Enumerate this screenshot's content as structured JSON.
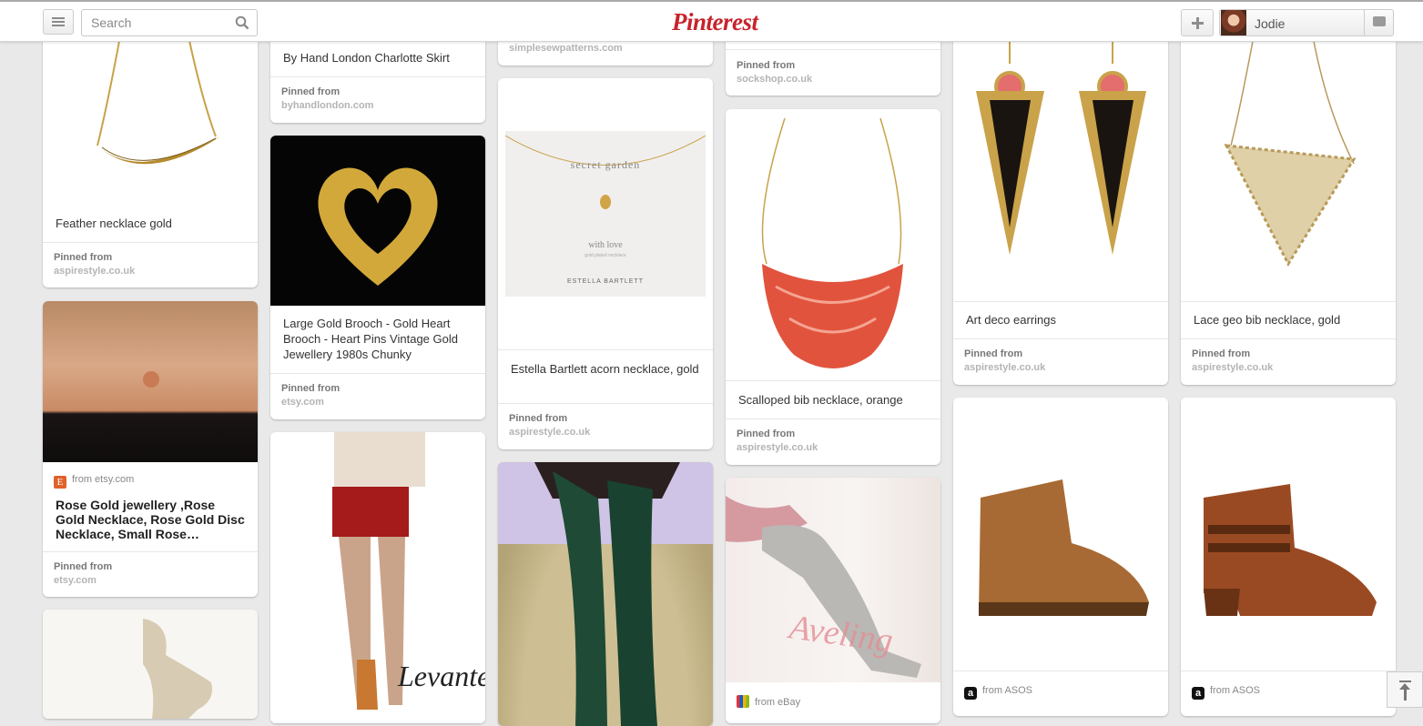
{
  "header": {
    "search_placeholder": "Search",
    "logo_text": "Pinterest",
    "user_name": "Jodie"
  },
  "pins": {
    "c1": [
      {
        "desc": "Feather necklace gold",
        "pinned_from_label": "Pinned from",
        "source": "aspirestyle.co.uk"
      },
      {
        "from_text": "from etsy.com",
        "desc": "Rose Gold jewellery ,Rose Gold Necklace, Rose Gold Disc Necklace, Small Rose…",
        "pinned_from_label": "Pinned from",
        "source": "etsy.com"
      }
    ],
    "c2": [
      {
        "desc": "By Hand London Charlotte Skirt",
        "pinned_from_label": "Pinned from",
        "source": "byhandlondon.com"
      },
      {
        "desc": "Large Gold Brooch - Gold Heart Brooch - Heart Pins Vintage Gold Jewellery 1980s Chunky",
        "pinned_from_label": "Pinned from",
        "source": "etsy.com"
      },
      {
        "watermark": "Levante"
      }
    ],
    "c3": [
      {
        "source": "simplesewpatterns.com"
      },
      {
        "card_title": "secret garden",
        "card_sub": "with love",
        "card_small": "gold plated necklace",
        "card_brand": "ESTELLA BARTLETT",
        "desc": "Estella Bartlett acorn necklace, gold",
        "pinned_from_label": "Pinned from",
        "source": "aspirestyle.co.uk"
      }
    ],
    "c4": [
      {
        "pinned_from_label": "Pinned from",
        "source": "sockshop.co.uk"
      },
      {
        "desc": "Scalloped bib necklace, orange",
        "pinned_from_label": "Pinned from",
        "source": "aspirestyle.co.uk"
      },
      {
        "watermark": "Aveling",
        "from_text": "from eBay"
      }
    ],
    "c5": [
      {
        "desc": "Art deco earrings",
        "pinned_from_label": "Pinned from",
        "source": "aspirestyle.co.uk"
      },
      {
        "from_text": "from ASOS"
      }
    ],
    "c6": [
      {
        "desc": "Lace geo bib necklace, gold",
        "pinned_from_label": "Pinned from",
        "source": "aspirestyle.co.uk"
      },
      {
        "from_text": "from ASOS"
      }
    ]
  }
}
